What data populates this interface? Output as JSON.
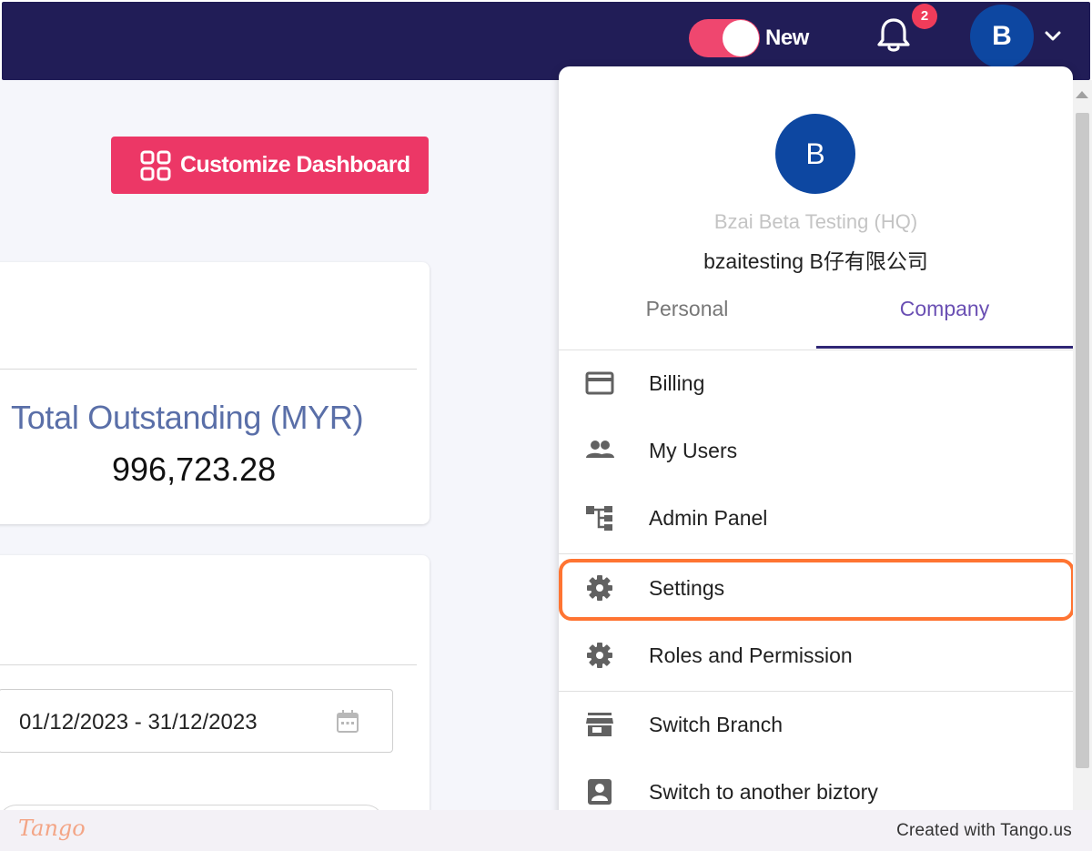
{
  "navbar": {
    "toggle_label": "New",
    "notification_count": "2",
    "avatar_initial": "B"
  },
  "dashboard": {
    "customize_button_label": "Customize Dashboard",
    "total_outstanding_label": "Total Outstanding (MYR)",
    "total_outstanding_value": "996,723.28",
    "date_range_value": "01/12/2023 - 31/12/2023"
  },
  "profile_menu": {
    "avatar_initial": "B",
    "organization_name": "Bzai Beta Testing (HQ)",
    "company_name": "bzaitesting B仔有限公司",
    "tabs": [
      {
        "label": "Personal",
        "active": false
      },
      {
        "label": "Company",
        "active": true
      }
    ],
    "items": [
      {
        "label": "Billing",
        "icon": "credit-card-icon"
      },
      {
        "label": "My Users",
        "icon": "users-icon"
      },
      {
        "label": "Admin Panel",
        "icon": "hierarchy-icon"
      },
      {
        "label": "Settings",
        "icon": "gear-icon",
        "highlighted": true
      },
      {
        "label": "Roles and Permission",
        "icon": "gear-icon"
      },
      {
        "label": "Switch Branch",
        "icon": "store-icon"
      },
      {
        "label": "Switch to another biztory",
        "icon": "account-box-icon"
      }
    ]
  },
  "footer": {
    "logo_text": "Tango",
    "credit_text": "Created with Tango.us"
  },
  "colors": {
    "navbar_bg": "#211d57",
    "accent_pink": "#ec3766",
    "avatar_blue": "#0d47a1",
    "tab_active": "#6a4fb3",
    "highlight_orange": "#ff7432"
  }
}
